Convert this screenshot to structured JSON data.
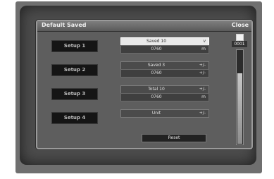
{
  "window": {
    "title": "Default Saved",
    "close_label": "Close"
  },
  "rows": [
    {
      "label": "Setup 1",
      "line1": {
        "value": "Saved 10",
        "unit": "v"
      },
      "line2": {
        "value": "0760",
        "unit": "m"
      },
      "selected": true
    },
    {
      "label": "Setup 2",
      "line1": {
        "value": "Saved 3",
        "unit": "+/-"
      },
      "line2": {
        "value": "0760",
        "unit": "+/-"
      },
      "selected": false
    },
    {
      "label": "Setup 3",
      "line1": {
        "value": "Total 10",
        "unit": "+/-"
      },
      "line2": {
        "value": "0760",
        "unit": "m"
      },
      "selected": false
    },
    {
      "label": "Setup 4",
      "line1": {
        "value": "Unit",
        "unit": "+/-"
      },
      "line2": null,
      "selected": false
    }
  ],
  "reset_label": "Reset",
  "side": {
    "icon": "square-icon",
    "label": "0001",
    "level": 0.75
  }
}
